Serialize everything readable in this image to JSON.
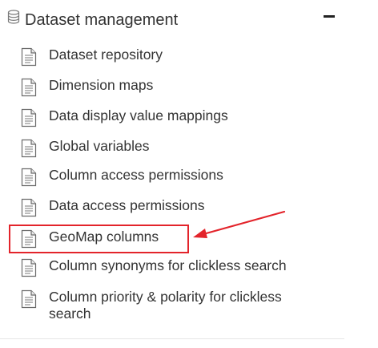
{
  "panel": {
    "title": "Dataset management",
    "header_icon": "database-icon",
    "collapse_icon": "minus-icon"
  },
  "items": [
    {
      "label": "Dataset repository",
      "icon": "document-icon"
    },
    {
      "label": "Dimension maps",
      "icon": "document-icon"
    },
    {
      "label": "Data display value mappings",
      "icon": "document-icon"
    },
    {
      "label": "Global variables",
      "icon": "document-icon"
    },
    {
      "label": "Column access permissions",
      "icon": "document-icon"
    },
    {
      "label": "Data access permissions",
      "icon": "document-icon"
    },
    {
      "label": "GeoMap columns",
      "icon": "document-icon",
      "highlighted": true
    },
    {
      "label": "Column synonyms for clickless search",
      "icon": "document-icon"
    },
    {
      "label": "Column priority & polarity for clickless search",
      "icon": "document-icon"
    }
  ],
  "annotation": {
    "color": "#e3242b",
    "arrow_icon": "red-arrow-annotation"
  }
}
